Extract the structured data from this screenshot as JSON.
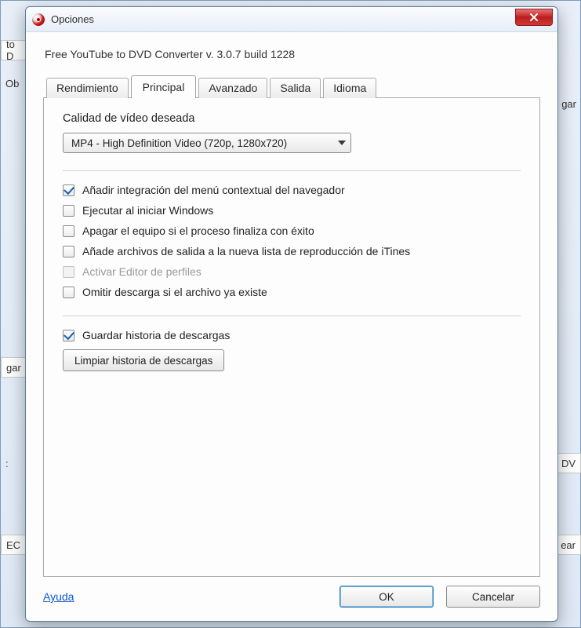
{
  "dialog": {
    "title": "Opciones",
    "app_title": "Free YouTube to DVD Converter  v. 3.0.7 build 1228",
    "help_label": "Ayuda",
    "ok_label": "OK",
    "cancel_label": "Cancelar"
  },
  "tabs": {
    "performance": "Rendimiento",
    "main": "Principal",
    "advanced": "Avanzado",
    "output": "Salida",
    "language": "Idioma",
    "active": "main"
  },
  "main_tab": {
    "quality_label": "Calidad de vídeo deseada",
    "quality_value": "MP4 - High Definition Video (720p, 1280x720)",
    "opt_context_menu": {
      "label": "Añadir integración del menú contextual del navegador",
      "checked": true
    },
    "opt_run_startup": {
      "label": "Ejecutar al iniciar Windows",
      "checked": false
    },
    "opt_shutdown": {
      "label": "Apagar el equipo si el proceso finaliza con éxito",
      "checked": false
    },
    "opt_itunes": {
      "label": "Añade archivos de salida a la nueva lista de reproducción de iTines",
      "checked": false
    },
    "opt_profile_editor": {
      "label": "Activar Editor de perfiles",
      "checked": false,
      "disabled": true
    },
    "opt_skip_existing": {
      "label": "Omitir descarga si el archivo ya existe",
      "checked": false
    },
    "opt_save_history": {
      "label": "Guardar historia de descargas",
      "checked": true
    },
    "clear_history_btn": "Limpiar historia de descargas"
  },
  "background": {
    "frag_to_d": "to D",
    "frag_ob": "Ob",
    "frag_gar1": "gar",
    "frag_gar2": "gar",
    "frag_colon": ":",
    "frag_ec": "EC",
    "frag_dv": "DV",
    "frag_ear": "ear"
  }
}
